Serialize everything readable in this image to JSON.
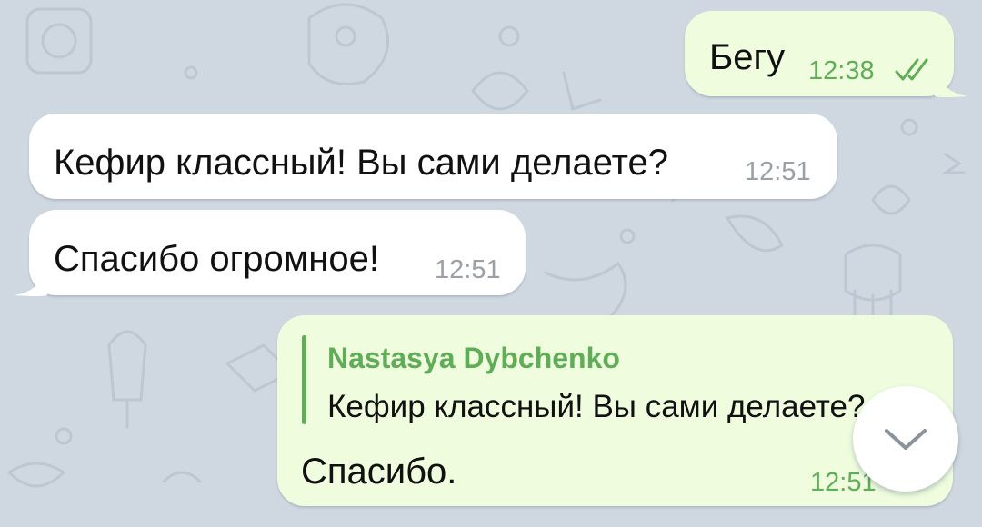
{
  "messages": [
    {
      "direction": "out",
      "text": "Бегу",
      "time": "12:38",
      "status": "read"
    },
    {
      "direction": "in",
      "text": "Кефир классный! Вы сами делаете?",
      "time": "12:51"
    },
    {
      "direction": "in",
      "text": "Спасибо огромное!",
      "time": "12:51"
    },
    {
      "direction": "out",
      "reply": {
        "author": "Nastasya Dybchenko",
        "text": "Кефир классный! Вы сами делаете?"
      },
      "text": "Спасибо.",
      "time": "12:51"
    }
  ],
  "colors": {
    "wallpaper": "#cfd8e1",
    "incoming_bubble": "#ffffff",
    "outgoing_bubble": "#effdde",
    "accent_green": "#5fad56",
    "time_gray": "#9aa0a6"
  },
  "icons": {
    "read_status": "double-check-icon",
    "scroll_down": "chevron-down-icon"
  }
}
